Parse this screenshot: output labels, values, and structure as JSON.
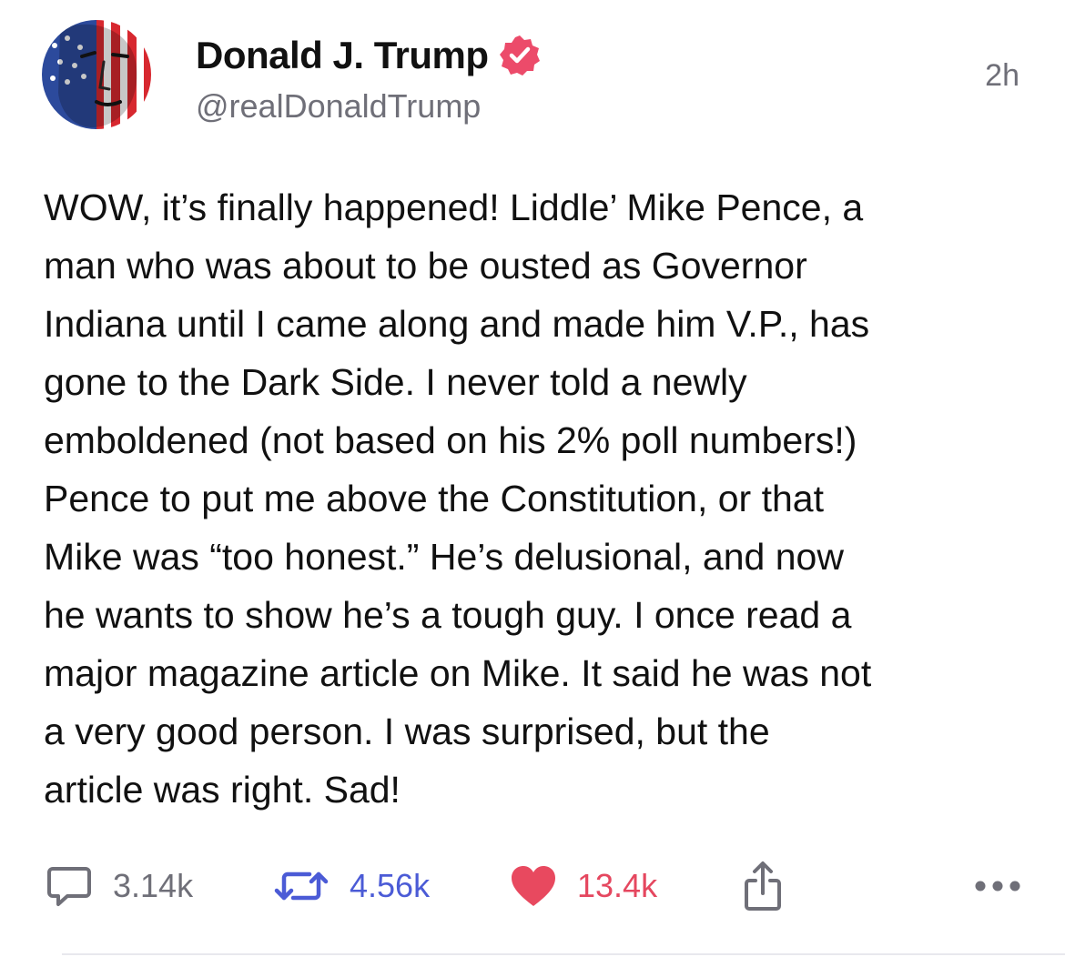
{
  "author": {
    "display_name": "Donald J. Trump",
    "handle": "@realDonaldTrump",
    "verified": true,
    "avatar_icon": "flag-portrait-avatar"
  },
  "timestamp": "2h",
  "post": {
    "text": "WOW, it’s finally happened! Liddle’ Mike Pence, a\nman who was about to be ousted as Governor\nIndiana until I came along and made him V.P., has\ngone to the Dark Side. I never told a newly\nemboldened (not based on his 2% poll numbers!)\nPence to put me above the Constitution, or that\nMike was “too honest.” He’s delusional, and now\nhe wants to show he’s a tough guy. I once read a\nmajor magazine article on Mike. It said he was not\na very good person. I was surprised, but the\narticle was right. Sad!"
  },
  "actions": {
    "reply": {
      "icon": "reply-icon",
      "count": "3.14k"
    },
    "repost": {
      "icon": "repost-icon",
      "count": "4.56k"
    },
    "like": {
      "icon": "heart-icon",
      "count": "13.4k"
    },
    "share": {
      "icon": "share-icon"
    },
    "more": {
      "icon": "more-icon"
    }
  },
  "colors": {
    "verified_badge": "#ec4b6a",
    "reply": "#6f6f78",
    "repost": "#4b5bd6",
    "like": "#e5475f",
    "secondary_text": "#6f6f78"
  }
}
